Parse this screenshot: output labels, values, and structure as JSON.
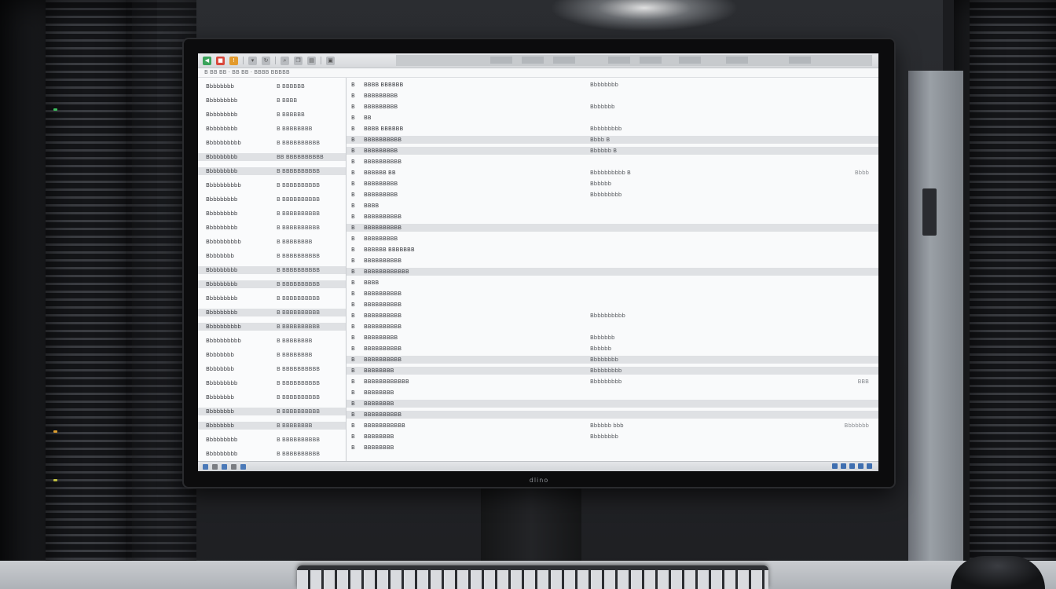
{
  "monitor": {
    "brand": "dlino"
  },
  "toolbar": {
    "icons": [
      "back-icon",
      "stop-icon",
      "warning-icon",
      "filter-icon",
      "refresh-icon",
      "search-icon",
      "copy-icon",
      "paste-icon",
      "lock-icon"
    ],
    "colors": {
      "green": "#3aa35a",
      "red": "#d9473b",
      "orange": "#e39a2c"
    }
  },
  "filterbar": {
    "text": "B  BB  BB  ·  BB  BB  ·  BBBB BBBBB"
  },
  "left_column": {
    "rows": [
      {
        "name": "Bbbbbbbb",
        "value": "B  BBBBBB",
        "band": false
      },
      {
        "name": "Bbbbbbbbb",
        "value": "B  BBBB",
        "band": false
      },
      {
        "name": "Bbbbbbbbb",
        "value": "B  BBBBBB",
        "band": false
      },
      {
        "name": "Bbbbbbbbb",
        "value": "B  BBBBBBBB",
        "band": false
      },
      {
        "name": "Bbbbbbbbbb",
        "value": "B  BBBBBBBBBB",
        "band": false
      },
      {
        "name": "Bbbbbbbbb",
        "value": "BB  BBBBBBBBBB",
        "band": true
      },
      {
        "name": "Bbbbbbbbb",
        "value": "B  BBBBBBBBBB",
        "band": true
      },
      {
        "name": "Bbbbbbbbbb",
        "value": "B  BBBBBBBBBB",
        "band": false
      },
      {
        "name": "Bbbbbbbbb",
        "value": "B  BBBBBBBBBB",
        "band": false
      },
      {
        "name": "Bbbbbbbbb",
        "value": "B  BBBBBBBBBB",
        "band": false
      },
      {
        "name": "Bbbbbbbbb",
        "value": "B  BBBBBBBBBB",
        "band": false
      },
      {
        "name": "Bbbbbbbbbb",
        "value": "B  BBBBBBBB",
        "band": false
      },
      {
        "name": "Bbbbbbbb",
        "value": "B  BBBBBBBBBB",
        "band": false
      },
      {
        "name": "Bbbbbbbbb",
        "value": "B  BBBBBBBBBB",
        "band": true
      },
      {
        "name": "Bbbbbbbbb",
        "value": "B  BBBBBBBBBB",
        "band": true
      },
      {
        "name": "Bbbbbbbbb",
        "value": "B  BBBBBBBBBB",
        "band": false
      },
      {
        "name": "Bbbbbbbbb",
        "value": "B  BBBBBBBBBB",
        "band": true
      },
      {
        "name": "Bbbbbbbbbb",
        "value": "B  BBBBBBBBBB",
        "band": true
      },
      {
        "name": "Bbbbbbbbbb",
        "value": "B  BBBBBBBB",
        "band": false
      },
      {
        "name": "Bbbbbbbb",
        "value": "B  BBBBBBBB",
        "band": false
      },
      {
        "name": "Bbbbbbbb",
        "value": "B  BBBBBBBBBB",
        "band": false
      },
      {
        "name": "Bbbbbbbbb",
        "value": "B  BBBBBBBBBB",
        "band": false
      },
      {
        "name": "Bbbbbbbb",
        "value": "B  BBBBBBBBBB",
        "band": false
      },
      {
        "name": "Bbbbbbbb",
        "value": "B  BBBBBBBBBB",
        "band": true
      },
      {
        "name": "Bbbbbbbb",
        "value": "B  BBBBBBBB",
        "band": true
      },
      {
        "name": "Bbbbbbbbb",
        "value": "B  BBBBBBBBBB",
        "band": false
      },
      {
        "name": "Bbbbbbbbb",
        "value": "B  BBBBBBBBBB",
        "band": false
      }
    ]
  },
  "main_column": {
    "rows": [
      {
        "a": "B",
        "b": "BBBB  BBBBBB",
        "c": "Bbbbbbbb",
        "d": "",
        "band": false
      },
      {
        "a": "B",
        "b": "BBBBBBBBB",
        "c": "",
        "d": "",
        "band": false
      },
      {
        "a": "B",
        "b": "BBBBBBBBB",
        "c": "Bbbbbbb",
        "d": "",
        "band": false
      },
      {
        "a": "B",
        "b": "BB",
        "c": "",
        "d": "",
        "band": false
      },
      {
        "a": "B",
        "b": "BBBB  BBBBBB",
        "c": "Bbbbbbbbb",
        "d": "",
        "band": false
      },
      {
        "a": "B",
        "b": "BBBBBBBBBB",
        "c": "Bbbb  B",
        "d": "",
        "band": true
      },
      {
        "a": "B",
        "b": "BBBBBBBBB",
        "c": "Bbbbbb  B",
        "d": "",
        "band": true
      },
      {
        "a": "B",
        "b": "BBBBBBBBBB",
        "c": "",
        "d": "",
        "band": false
      },
      {
        "a": "B",
        "b": "BBBBBB  BB",
        "c": "Bbbbbbbbbb  B",
        "d": "Bbbb",
        "band": false
      },
      {
        "a": "B",
        "b": "BBBBBBBBB",
        "c": "Bbbbbb",
        "d": "",
        "band": false
      },
      {
        "a": "B",
        "b": "BBBBBBBBB",
        "c": "Bbbbbbbbb",
        "d": "",
        "band": false
      },
      {
        "a": "B",
        "b": "BBBB",
        "c": "",
        "d": "",
        "band": false
      },
      {
        "a": "B",
        "b": "BBBBBBBBBB",
        "c": "",
        "d": "",
        "band": false
      },
      {
        "a": "B",
        "b": "BBBBBBBBBB",
        "c": "",
        "d": "",
        "band": true
      },
      {
        "a": "B",
        "b": "BBBBBBBBB",
        "c": "",
        "d": "",
        "band": false
      },
      {
        "a": "B",
        "b": "BBBBBB  BBBBBBB",
        "c": "",
        "d": "",
        "band": false
      },
      {
        "a": "B",
        "b": "BBBBBBBBBB",
        "c": "",
        "d": "",
        "band": false
      },
      {
        "a": "B",
        "b": "BBBBBBBBBBBB",
        "c": "",
        "d": "",
        "band": true
      },
      {
        "a": "B",
        "b": "BBBB",
        "c": "",
        "d": "",
        "band": false
      },
      {
        "a": "B",
        "b": "BBBBBBBBBB",
        "c": "",
        "d": "",
        "band": false
      },
      {
        "a": "B",
        "b": "BBBBBBBBBB",
        "c": "",
        "d": "",
        "band": false
      },
      {
        "a": "B",
        "b": "BBBBBBBBBB",
        "c": "Bbbbbbbbbb",
        "d": "",
        "band": false
      },
      {
        "a": "B",
        "b": "BBBBBBBBBB",
        "c": "",
        "d": "",
        "band": false
      },
      {
        "a": "B",
        "b": "BBBBBBBBB",
        "c": "Bbbbbbb",
        "d": "",
        "band": false
      },
      {
        "a": "B",
        "b": "BBBBBBBBBB",
        "c": "Bbbbbb",
        "d": "",
        "band": false
      },
      {
        "a": "B",
        "b": "BBBBBBBBBB",
        "c": "Bbbbbbbb",
        "d": "",
        "band": true
      },
      {
        "a": "B",
        "b": "BBBBBBBB",
        "c": "Bbbbbbbbb",
        "d": "",
        "band": true
      },
      {
        "a": "B",
        "b": "BBBBBBBBBBBB",
        "c": "Bbbbbbbbb",
        "d": "BBB",
        "band": false
      },
      {
        "a": "B",
        "b": "BBBBBBBB",
        "c": "",
        "d": "",
        "band": false
      },
      {
        "a": "B",
        "b": "BBBBBBBB",
        "c": "",
        "d": "",
        "band": true
      },
      {
        "a": "B",
        "b": "BBBBBBBBBB",
        "c": "",
        "d": "",
        "band": true
      },
      {
        "a": "B",
        "b": "BBBBBBBBBBB",
        "c": "Bbbbbb  bbb",
        "d": "Bbbbbbb",
        "band": false
      },
      {
        "a": "B",
        "b": "BBBBBBBB",
        "c": "Bbbbbbbb",
        "d": "",
        "band": false
      },
      {
        "a": "B",
        "b": "BBBBBBBB",
        "c": "",
        "d": "",
        "band": false
      }
    ]
  }
}
